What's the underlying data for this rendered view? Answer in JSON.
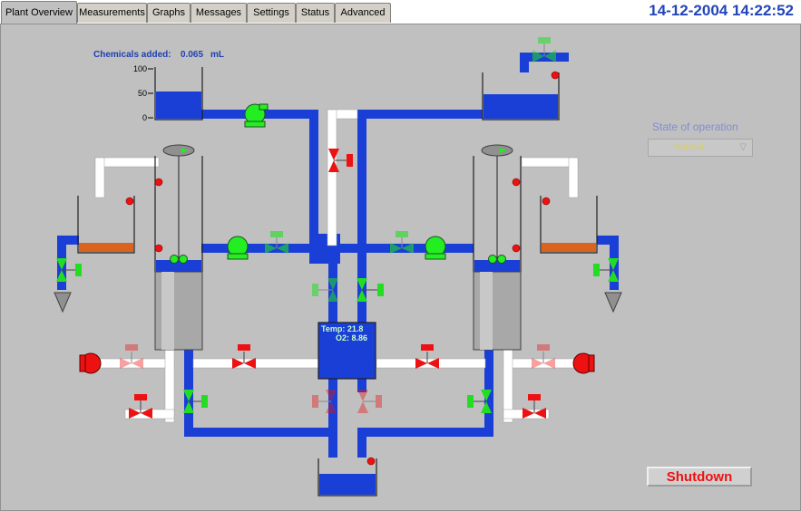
{
  "tabs": [
    {
      "label": "Plant Overview",
      "active": true
    },
    {
      "label": "Measurements"
    },
    {
      "label": "Graphs"
    },
    {
      "label": "Messages"
    },
    {
      "label": "Settings"
    },
    {
      "label": "Status"
    },
    {
      "label": "Advanced"
    }
  ],
  "datetime": "14-12-2004 14:22:52",
  "chemicals": {
    "label": "Chemicals added:",
    "value": "0.065",
    "unit": "mL",
    "gauge_ticks": [
      "100",
      "50",
      "0"
    ]
  },
  "state_of_operation": {
    "label": "State of operation",
    "value": "Normal"
  },
  "sensor": {
    "temp": "Temp: 21.8",
    "o2": "O2: 8.86"
  },
  "shutdown_label": "Shutdown",
  "colors": {
    "pipe_blue": "#1a3fd6",
    "pipe_white": "#ffffff",
    "valve_open": "#22dd22",
    "valve_closed": "#ee1111",
    "pump_on": "#22ee22",
    "pump_off": "#ee1111",
    "sludge": "#d86420",
    "panel_grey": "#c0c0c0",
    "accent": "#2345b8"
  }
}
